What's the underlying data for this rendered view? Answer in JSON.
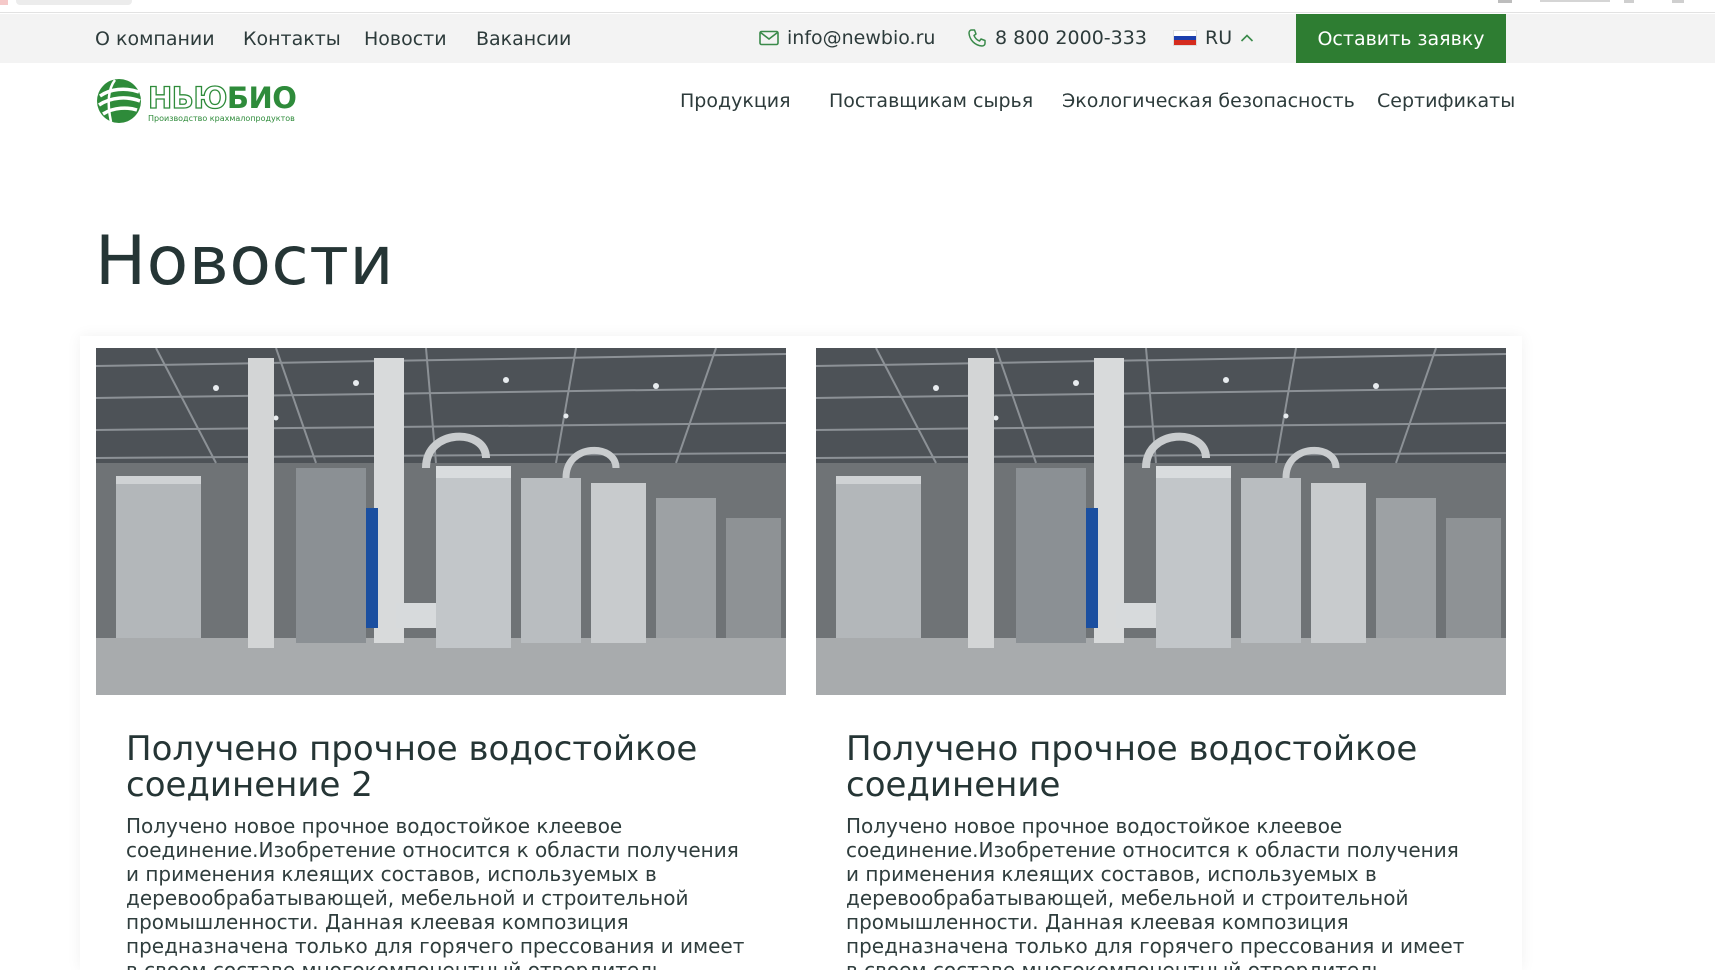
{
  "topbar": {
    "links": [
      "О компании",
      "Контакты",
      "Новости",
      "Вакансии"
    ],
    "email": "info@newbio.ru",
    "phone": "8 800 2000-333",
    "language": "RU",
    "cta_label": "Оставить заявку",
    "icons": {
      "email": "envelope-icon",
      "phone": "phone-icon",
      "language": "russian-flag-icon",
      "language_toggle": "chevron-up-icon"
    }
  },
  "logo": {
    "name_part1": "НЬЮ",
    "name_part2": "БИО",
    "tagline": "Производство крахмалопродуктов"
  },
  "nav": {
    "items": [
      "Продукция",
      "Поставщикам сырья",
      "Экологическая безопасность",
      "Сертификаты"
    ]
  },
  "page": {
    "title": "Новости"
  },
  "news": [
    {
      "title": "Получено прочное водостойкое соединение 2",
      "text": "Получено новое прочное водостойкое клеевое соединение.Изобретение относится к области получения и применения клеящих составов, используемых в деревообрабатывающей, мебельной и строительной промышленности. Данная клеевая композиция предназначена только для горячего прессования и имеет в своем составе многокомпонентный отвердитель"
    },
    {
      "title": "Получено прочное водостойкое соединение",
      "text": "Получено новое прочное водостойкое клеевое соединение.Изобретение относится к области получения и применения клеящих составов, используемых в деревообрабатывающей, мебельной и строительной промышленности. Данная клеевая композиция предназначена только для горячего прессования и имеет в своем составе многокомпонентный отвердитель"
    }
  ],
  "colors": {
    "brand_green": "#2e7d32",
    "logo_green": "#2e8b3a",
    "text_dark": "#253535",
    "topbar_bg": "#f3f3f3"
  }
}
